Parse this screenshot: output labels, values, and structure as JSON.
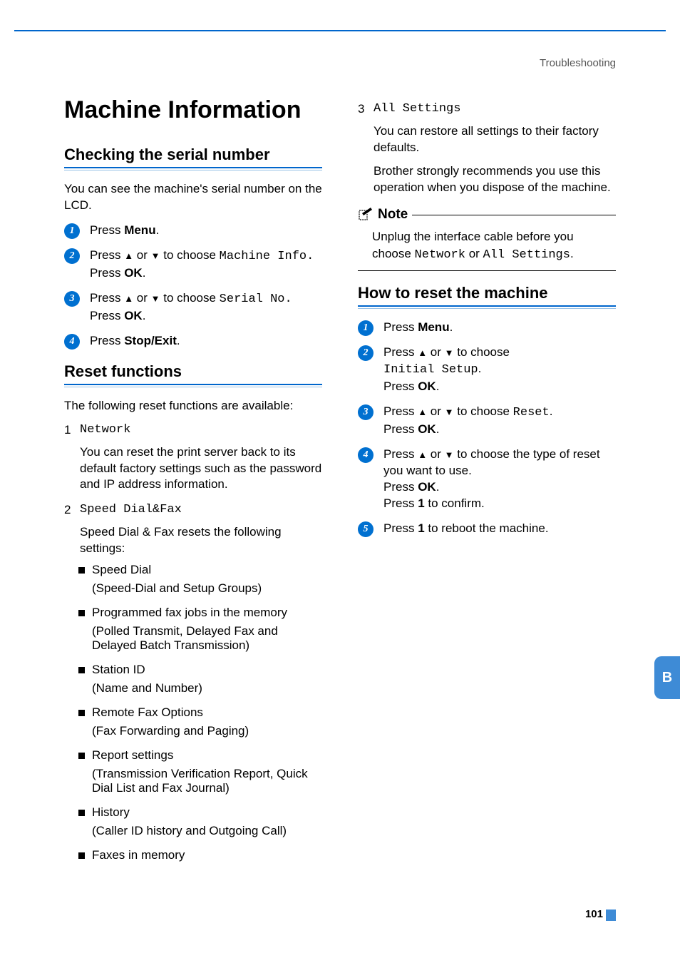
{
  "header": {
    "section": "Troubleshooting"
  },
  "left": {
    "title": "Machine Information",
    "sec1": {
      "heading": "Checking the serial number",
      "intro": "You can see the machine's serial number on the LCD.",
      "step1": {
        "a": "Press ",
        "b": "Menu",
        "c": "."
      },
      "step2": {
        "a": "Press ",
        "up": "▲",
        "mid1": " or ",
        "down": "▼",
        "mid2": " to choose ",
        "code": "Machine Info.",
        "br": "Press ",
        "ok": "OK",
        "end": "."
      },
      "step3": {
        "a": "Press ",
        "up": "▲",
        "mid1": " or ",
        "down": "▼",
        "mid2": " to choose ",
        "code": "Serial No.",
        "br": "Press ",
        "ok": "OK",
        "end": "."
      },
      "step4": {
        "a": "Press ",
        "b": "Stop/Exit",
        "c": "."
      }
    },
    "sec2": {
      "heading": "Reset functions",
      "intro": "The following reset functions are available:",
      "item1": {
        "num": "1",
        "code": "Network",
        "desc": "You can reset the print server back to its default factory settings such as the password and IP address information."
      },
      "item2": {
        "num": "2",
        "code": "Speed Dial&Fax",
        "desc": "Speed Dial & Fax resets the following settings:",
        "b1": {
          "t": "Speed Dial",
          "s": "(Speed-Dial and Setup Groups)"
        },
        "b2": {
          "t": "Programmed fax jobs in the memory",
          "s": "(Polled Transmit, Delayed Fax and Delayed Batch Transmission)"
        },
        "b3": {
          "t": "Station ID",
          "s": "(Name and Number)"
        },
        "b4": {
          "t": "Remote Fax Options",
          "s": "(Fax Forwarding and Paging)"
        },
        "b5": {
          "t": "Report settings",
          "s": "(Transmission Verification Report, Quick Dial List and Fax Journal)"
        },
        "b6": {
          "t": "History",
          "s": "(Caller ID history and Outgoing Call)"
        },
        "b7": {
          "t": "Faxes in memory"
        }
      }
    }
  },
  "right": {
    "item3": {
      "num": "3",
      "code": "All Settings",
      "desc1": "You can restore all settings to their factory defaults.",
      "desc2": "Brother strongly recommends you use this operation when you dispose of the machine."
    },
    "note": {
      "title": "Note",
      "body": {
        "a": "Unplug the interface cable before you choose ",
        "c1": "Network",
        "mid": " or ",
        "c2": "All Settings",
        "end": "."
      }
    },
    "sec3": {
      "heading": "How to reset the machine",
      "step1": {
        "a": "Press ",
        "b": "Menu",
        "c": "."
      },
      "step2": {
        "a": "Press ",
        "up": "▲",
        "mid1": " or ",
        "down": "▼",
        "mid2": " to choose",
        "code": "Initial Setup",
        "dot": ".",
        "br": "Press ",
        "ok": "OK",
        "end": "."
      },
      "step3": {
        "a": "Press ",
        "up": "▲",
        "mid1": " or ",
        "down": "▼",
        "mid2": " to choose ",
        "code": "Reset",
        "dot": ".",
        "br": "Press ",
        "ok": "OK",
        "end": "."
      },
      "step4": {
        "a": "Press ",
        "up": "▲",
        "mid1": " or ",
        "down": "▼",
        "mid2": " to choose the type of reset you want to use.",
        "br": "Press ",
        "ok": "OK",
        "end": ".",
        "br2": "Press ",
        "one": "1",
        "conf": " to confirm."
      },
      "step5": {
        "a": "Press ",
        "one": "1",
        "b": " to reboot the machine."
      }
    }
  },
  "tab": "B",
  "page": "101"
}
